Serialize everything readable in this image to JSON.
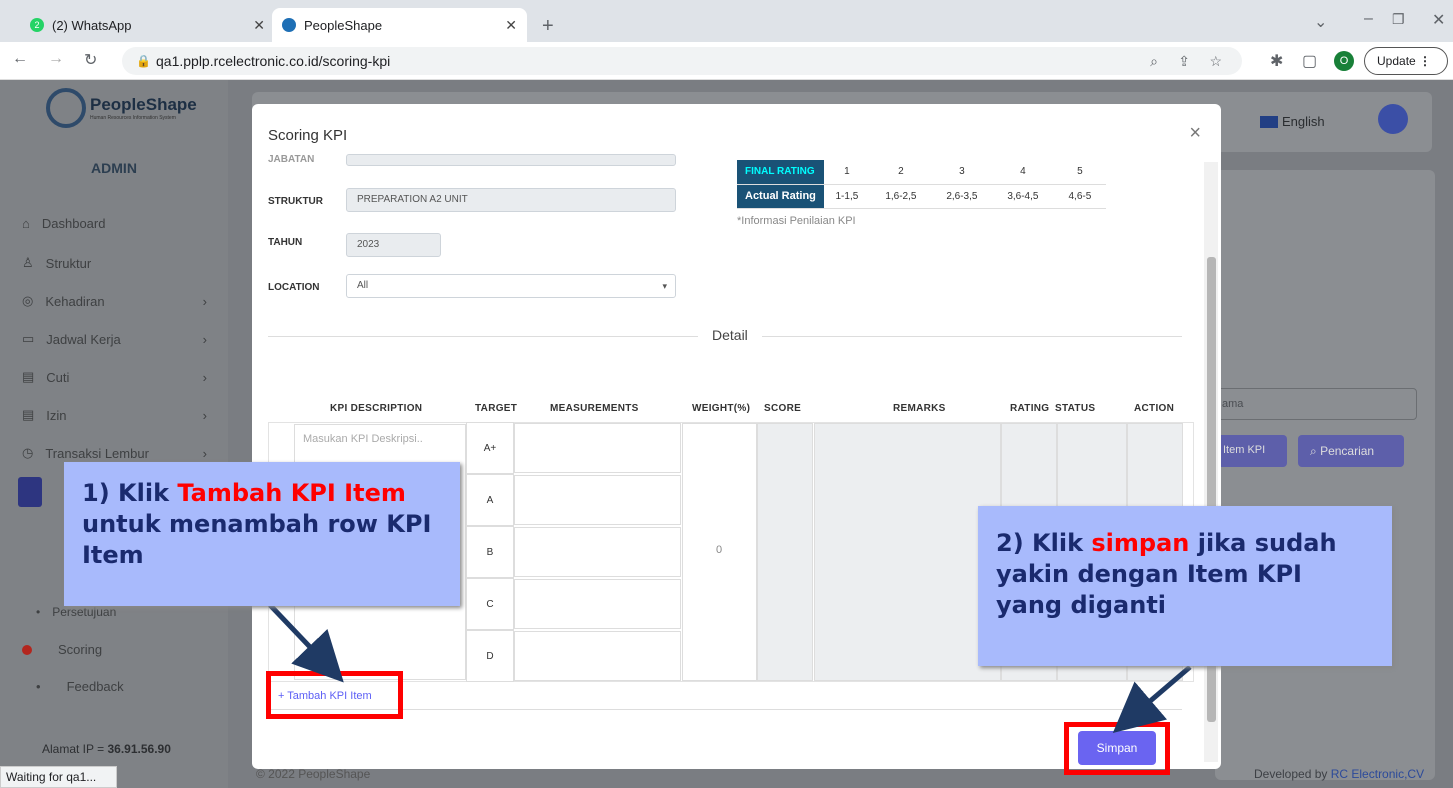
{
  "browser": {
    "tabs": [
      {
        "label": "(2) WhatsApp",
        "badge": "2"
      },
      {
        "label": "PeopleShape"
      }
    ],
    "url": "qa1.pplp.rcelectronic.co.id/scoring-kpi",
    "update_label": "Update",
    "profile_initial": "O"
  },
  "sidebar": {
    "brand": "PeopleShape",
    "brand_sub": "Human Resources Information System",
    "role": "ADMIN",
    "items": [
      {
        "label": "Dashboard",
        "icon": "home-icon"
      },
      {
        "label": "Struktur",
        "icon": "org-icon"
      },
      {
        "label": "Kehadiran",
        "icon": "fingerprint-icon"
      },
      {
        "label": "Jadwal Kerja",
        "icon": "briefcase-icon"
      },
      {
        "label": "Cuti",
        "icon": "calendar-icon"
      },
      {
        "label": "Izin",
        "icon": "calendar-icon"
      },
      {
        "label": "Transaksi Lembur",
        "icon": "clock-icon"
      }
    ],
    "sub_items": [
      "Persetujuan",
      "Scoring",
      "Feedback"
    ],
    "ip_label": "Alamat IP",
    "ip_value": "36.91.56.90"
  },
  "header": {
    "language": "English"
  },
  "background": {
    "search_placeholder": "ama",
    "item_kpi_label": "Item KPI",
    "search_label": "Pencarian"
  },
  "modal": {
    "title": "Scoring KPI",
    "fields": {
      "jabatan_label": "JABATAN",
      "struktur_label": "STRUKTUR",
      "struktur_value": "PREPARATION A2 UNIT",
      "tahun_label": "TAHUN",
      "tahun_value": "2023",
      "location_label": "LOCATION",
      "location_value": "All"
    },
    "rating_table": {
      "final_label": "FINAL RATING",
      "actual_label": "Actual Rating",
      "levels": [
        "1",
        "2",
        "3",
        "4",
        "5"
      ],
      "ranges": [
        "1-1,5",
        "1,6-2,5",
        "2,6-3,5",
        "3,6-4,5",
        "4,6-5"
      ]
    },
    "info_note": "*Informasi Penilaian KPI",
    "detail_label": "Detail",
    "columns": [
      "KPI DESCRIPTION",
      "TARGET",
      "MEASUREMENTS",
      "WEIGHT(%)",
      "SCORE",
      "REMARKS",
      "RATING",
      "STATUS",
      "ACTION"
    ],
    "kpi_placeholder": "Masukan KPI Deskripsi..",
    "targets": [
      "A+",
      "A",
      "B",
      "C",
      "D"
    ],
    "weight_value": "0",
    "add_item_label": "+ Tambah KPI Item",
    "save_label": "Simpan"
  },
  "annotations": {
    "note1_prefix": "1) Klik ",
    "note1_highlight": "Tambah KPI Item",
    "note1_suffix": " untuk menambah row KPI Item",
    "note2_prefix": "2) Klik ",
    "note2_highlight": "simpan",
    "note2_suffix": " jika sudah yakin dengan Item KPI yang diganti"
  },
  "footer": {
    "copyright": "© 2022 PeopleShape",
    "developed_prefix": "Developed by ",
    "developed_name": "RC Electronic,CV"
  },
  "status_bar": "Waiting for qa1..."
}
